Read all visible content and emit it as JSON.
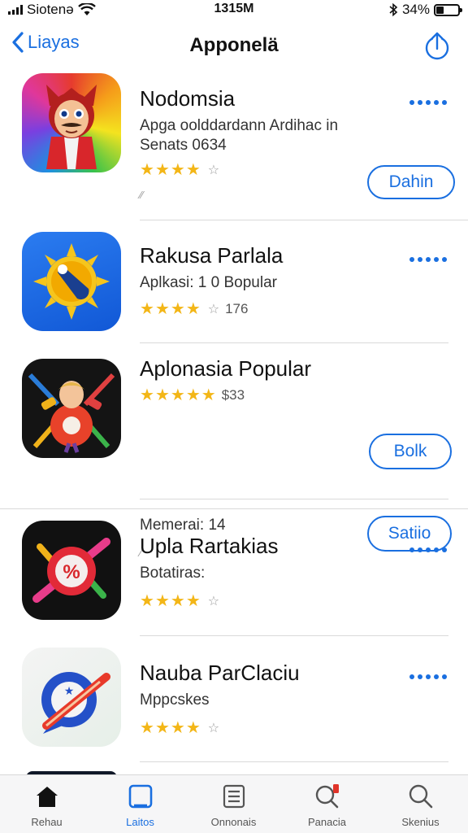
{
  "status_bar": {
    "carrier": "Siotenə",
    "time": "1315M",
    "battery": "34%",
    "battery_level": 0.34
  },
  "nav": {
    "back_label": "Liayas",
    "title": "Apponelä",
    "share_icon": "share-icon"
  },
  "apps": [
    {
      "name": "Nodomsia",
      "subtitle_1": "Apga oolddardann Ardihac in",
      "subtitle_2": "Senats 0634",
      "rating": 4,
      "mark": "⁄⁄",
      "button": "Dahin"
    },
    {
      "name": "Rakusa Parlala",
      "subtitle_1": "Aplkasi: 1 0 Bopular",
      "rating": 4,
      "rating_count": "176"
    },
    {
      "name": "Aplonasia Popular",
      "rating": 5,
      "rating_count": "$33",
      "button": "Bolk",
      "secondary_text": "Memerai: 14",
      "secondary_button": "Satiio",
      "mark": "⁄"
    },
    {
      "name": "Upla Rartakias",
      "subtitle_1": "Botatiras:",
      "rating": 4
    },
    {
      "name": "Nauba ParClaciu",
      "subtitle_1": "Mppcskes",
      "rating": 4
    }
  ],
  "tabs": [
    {
      "label": "Rehau",
      "icon": "home-icon",
      "active": false
    },
    {
      "label": "Laitos",
      "icon": "square-icon",
      "active": true
    },
    {
      "label": "Onnonais",
      "icon": "list-icon",
      "active": false
    },
    {
      "label": "Panacia",
      "icon": "search-badge-icon",
      "active": false
    },
    {
      "label": "Skenius",
      "icon": "search-icon",
      "active": false
    }
  ],
  "colors": {
    "accent": "#1a6fe0",
    "star": "#f3b617"
  }
}
